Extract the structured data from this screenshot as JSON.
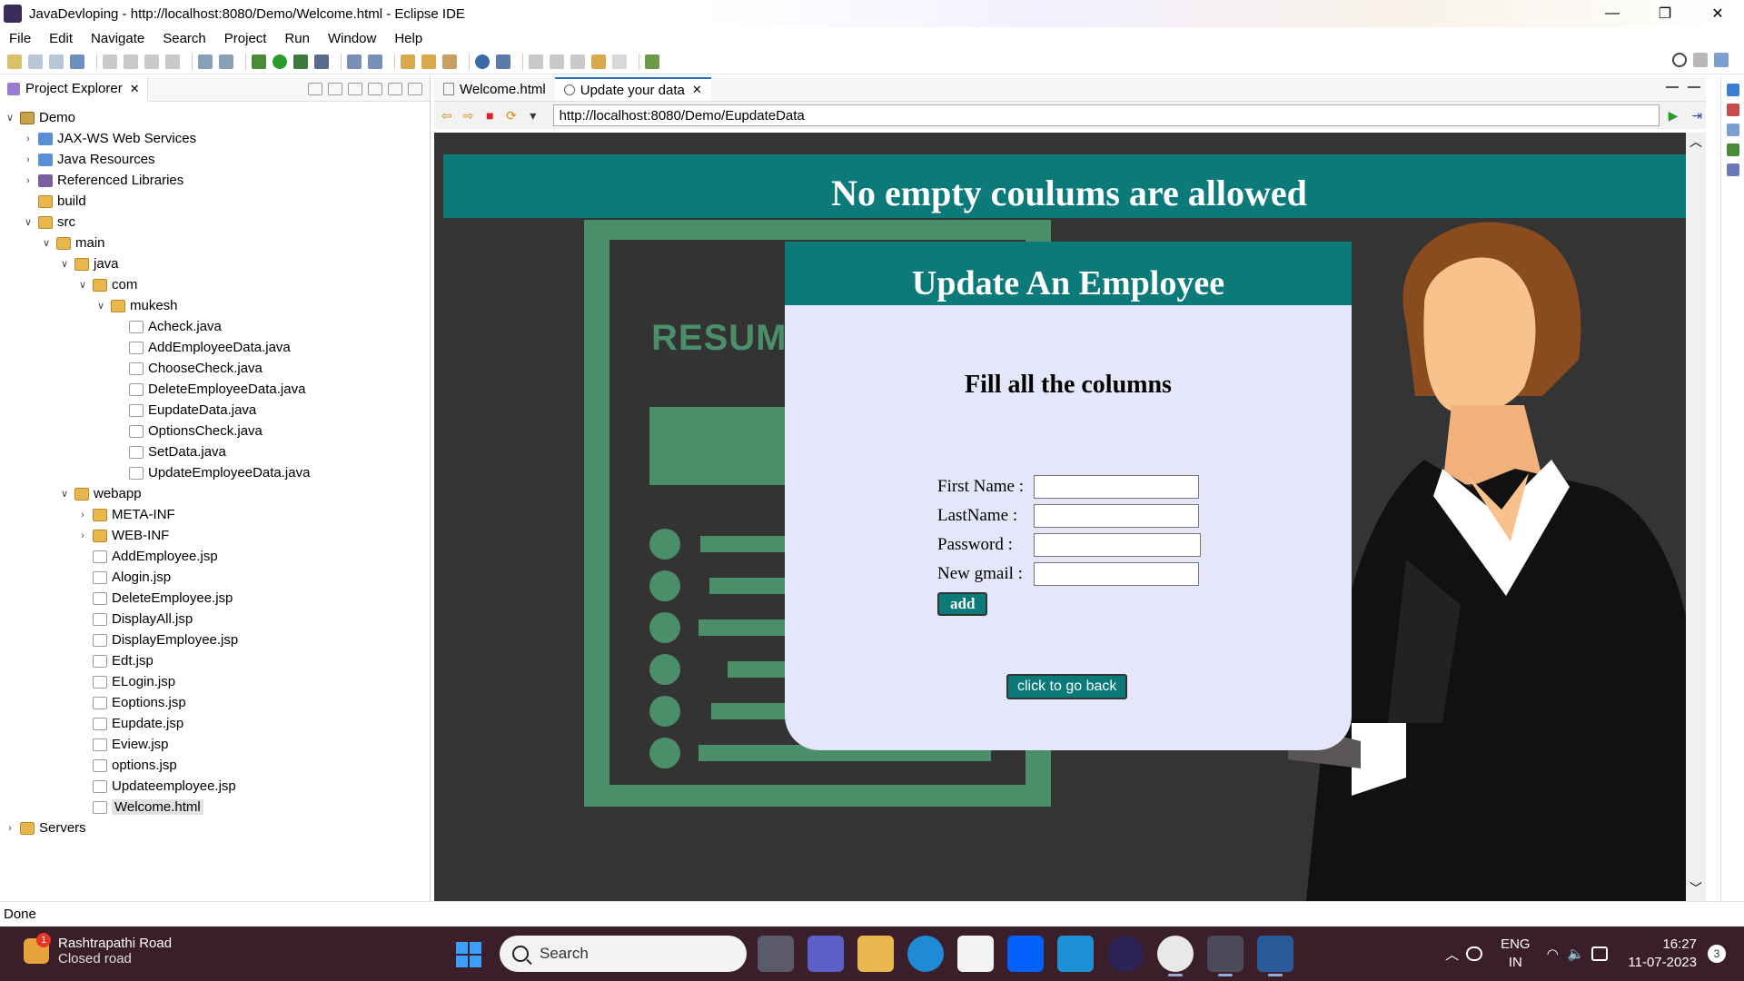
{
  "window": {
    "title": "JavaDevloping - http://localhost:8080/Demo/Welcome.html - Eclipse IDE",
    "controls": [
      "—",
      "❐",
      "✕"
    ]
  },
  "menu": [
    "File",
    "Edit",
    "Navigate",
    "Search",
    "Project",
    "Run",
    "Window",
    "Help"
  ],
  "project_explorer": {
    "tab_label": "Project Explorer",
    "close": "✕",
    "tree": [
      {
        "label": "Demo",
        "depth": 0,
        "chev": "∨",
        "icon": "project"
      },
      {
        "label": "JAX-WS Web Services",
        "depth": 1,
        "chev": "›",
        "icon": "service"
      },
      {
        "label": "Java Resources",
        "depth": 1,
        "chev": "›",
        "icon": "service"
      },
      {
        "label": "Referenced Libraries",
        "depth": 1,
        "chev": "›",
        "icon": "lib"
      },
      {
        "label": "build",
        "depth": 1,
        "chev": "",
        "icon": "folder"
      },
      {
        "label": "src",
        "depth": 1,
        "chev": "∨",
        "icon": "folder"
      },
      {
        "label": "main",
        "depth": 2,
        "chev": "∨",
        "icon": "folder"
      },
      {
        "label": "java",
        "depth": 3,
        "chev": "∨",
        "icon": "folder"
      },
      {
        "label": "com",
        "depth": 4,
        "chev": "∨",
        "icon": "folder"
      },
      {
        "label": "mukesh",
        "depth": 5,
        "chev": "∨",
        "icon": "folder"
      },
      {
        "label": "Acheck.java",
        "depth": 6,
        "chev": "",
        "icon": "java"
      },
      {
        "label": "AddEmployeeData.java",
        "depth": 6,
        "chev": "",
        "icon": "java"
      },
      {
        "label": "ChooseCheck.java",
        "depth": 6,
        "chev": "",
        "icon": "java"
      },
      {
        "label": "DeleteEmployeeData.java",
        "depth": 6,
        "chev": "",
        "icon": "java"
      },
      {
        "label": "EupdateData.java",
        "depth": 6,
        "chev": "",
        "icon": "java"
      },
      {
        "label": "OptionsCheck.java",
        "depth": 6,
        "chev": "",
        "icon": "java"
      },
      {
        "label": "SetData.java",
        "depth": 6,
        "chev": "",
        "icon": "java"
      },
      {
        "label": "UpdateEmployeeData.java",
        "depth": 6,
        "chev": "",
        "icon": "java"
      },
      {
        "label": "webapp",
        "depth": 3,
        "chev": "∨",
        "icon": "folder"
      },
      {
        "label": "META-INF",
        "depth": 4,
        "chev": "›",
        "icon": "folder"
      },
      {
        "label": "WEB-INF",
        "depth": 4,
        "chev": "›",
        "icon": "folder"
      },
      {
        "label": "AddEmployee.jsp",
        "depth": 4,
        "chev": "",
        "icon": "file"
      },
      {
        "label": "Alogin.jsp",
        "depth": 4,
        "chev": "",
        "icon": "file"
      },
      {
        "label": "DeleteEmployee.jsp",
        "depth": 4,
        "chev": "",
        "icon": "file"
      },
      {
        "label": "DisplayAll.jsp",
        "depth": 4,
        "chev": "",
        "icon": "file"
      },
      {
        "label": "DisplayEmployee.jsp",
        "depth": 4,
        "chev": "",
        "icon": "file"
      },
      {
        "label": "Edt.jsp",
        "depth": 4,
        "chev": "",
        "icon": "file"
      },
      {
        "label": "ELogin.jsp",
        "depth": 4,
        "chev": "",
        "icon": "file"
      },
      {
        "label": "Eoptions.jsp",
        "depth": 4,
        "chev": "",
        "icon": "file"
      },
      {
        "label": "Eupdate.jsp",
        "depth": 4,
        "chev": "",
        "icon": "file"
      },
      {
        "label": "Eview.jsp",
        "depth": 4,
        "chev": "",
        "icon": "file"
      },
      {
        "label": "options.jsp",
        "depth": 4,
        "chev": "",
        "icon": "file"
      },
      {
        "label": "Updateemployee.jsp",
        "depth": 4,
        "chev": "",
        "icon": "file"
      },
      {
        "label": "Welcome.html",
        "depth": 4,
        "chev": "",
        "icon": "file",
        "selected": true
      },
      {
        "label": "Servers",
        "depth": 0,
        "chev": "›",
        "icon": "folder"
      }
    ]
  },
  "browser": {
    "tabs": [
      {
        "label": "Welcome.html",
        "active": false
      },
      {
        "label": "Update your data",
        "active": true,
        "close": "✕"
      }
    ],
    "url": "http://localhost:8080/Demo/EupdateData"
  },
  "page": {
    "banner": "No empty coulums are allowed",
    "background_word": "RESUM",
    "card_title": "Update An Employee",
    "subtitle": "Fill all the columns",
    "fields": [
      {
        "label": "First Name :",
        "value": ""
      },
      {
        "label": "LastName :",
        "value": ""
      },
      {
        "label": "Password :",
        "value": ""
      },
      {
        "label": "New gmail :",
        "value": ""
      }
    ],
    "add_button": "add",
    "back_button": "click to go back"
  },
  "status": "Done",
  "taskbar": {
    "weather_title": "Rashtrapathi Road",
    "weather_sub": "Closed road",
    "weather_badge": "1",
    "search_placeholder": "Search",
    "lang_1": "ENG",
    "lang_2": "IN",
    "time": "16:27",
    "date": "11-07-2023",
    "notifications": "3"
  },
  "colors": {
    "teal": "#0b7a78",
    "card_bg": "#e6e6fa",
    "page_bg": "#343434",
    "resume_green": "#4b8f6a"
  }
}
